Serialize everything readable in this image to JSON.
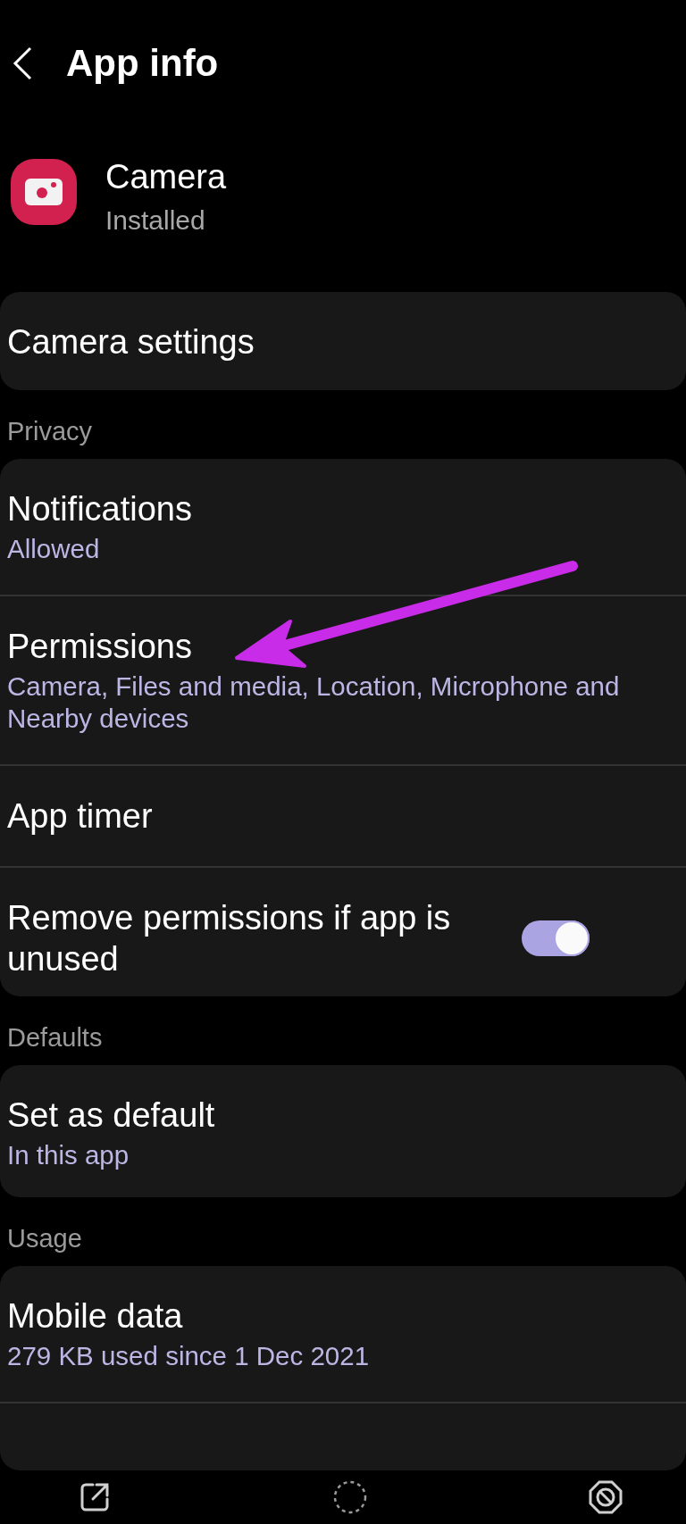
{
  "header": {
    "title": "App info"
  },
  "app": {
    "name": "Camera",
    "status": "Installed"
  },
  "groups": [
    {
      "items": [
        {
          "kind": "link",
          "title": "Camera settings"
        }
      ]
    },
    {
      "label": "Privacy",
      "items": [
        {
          "kind": "link",
          "title": "Notifications",
          "subtitle": "Allowed"
        },
        {
          "kind": "link",
          "title": "Permissions",
          "subtitle": "Camera, Files and media, Location, Microphone and Nearby devices"
        },
        {
          "kind": "link",
          "title": "App timer"
        },
        {
          "kind": "toggle",
          "title": "Remove permissions if app is unused",
          "on": true
        }
      ]
    },
    {
      "label": "Defaults",
      "items": [
        {
          "kind": "link",
          "title": "Set as default",
          "subtitle": "In this app"
        }
      ]
    },
    {
      "label": "Usage",
      "items": [
        {
          "kind": "link",
          "title": "Mobile data",
          "subtitle": "279 KB used since 1 Dec 2021"
        }
      ],
      "more_below": true
    }
  ],
  "annotations": [
    {
      "kind": "arrow"
    }
  ],
  "bottom_bar": [
    {
      "kind": "open"
    },
    {
      "kind": "home"
    },
    {
      "kind": "stop"
    }
  ]
}
